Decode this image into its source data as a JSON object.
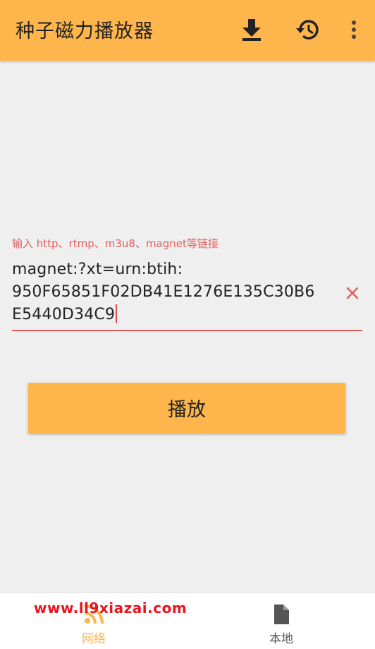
{
  "app": {
    "title": "种子磁力播放器"
  },
  "toolbar": {
    "icons": [
      "download-icon",
      "history-icon",
      "more-vert-icon"
    ]
  },
  "form": {
    "hint_label": "输入 http、rtmp、m3u8、magnet等链接",
    "input_value": "magnet:?xt=urn:btih:\n950F65851F02DB41E1276E135C30B6\nE5440D34C9",
    "clear_icon": "close-icon"
  },
  "play_button": {
    "label": "播放"
  },
  "bottom_nav": {
    "items": [
      {
        "label": "网络",
        "icon": "rss-icon",
        "active": true
      },
      {
        "label": "本地",
        "icon": "file-icon",
        "active": false
      }
    ]
  },
  "watermark": {
    "text": "www.ll9xiazai.com"
  },
  "colors": {
    "accent": "#fdb54c",
    "error": "#e35d5d",
    "watermark": "#e8141e",
    "background": "#efefef"
  }
}
